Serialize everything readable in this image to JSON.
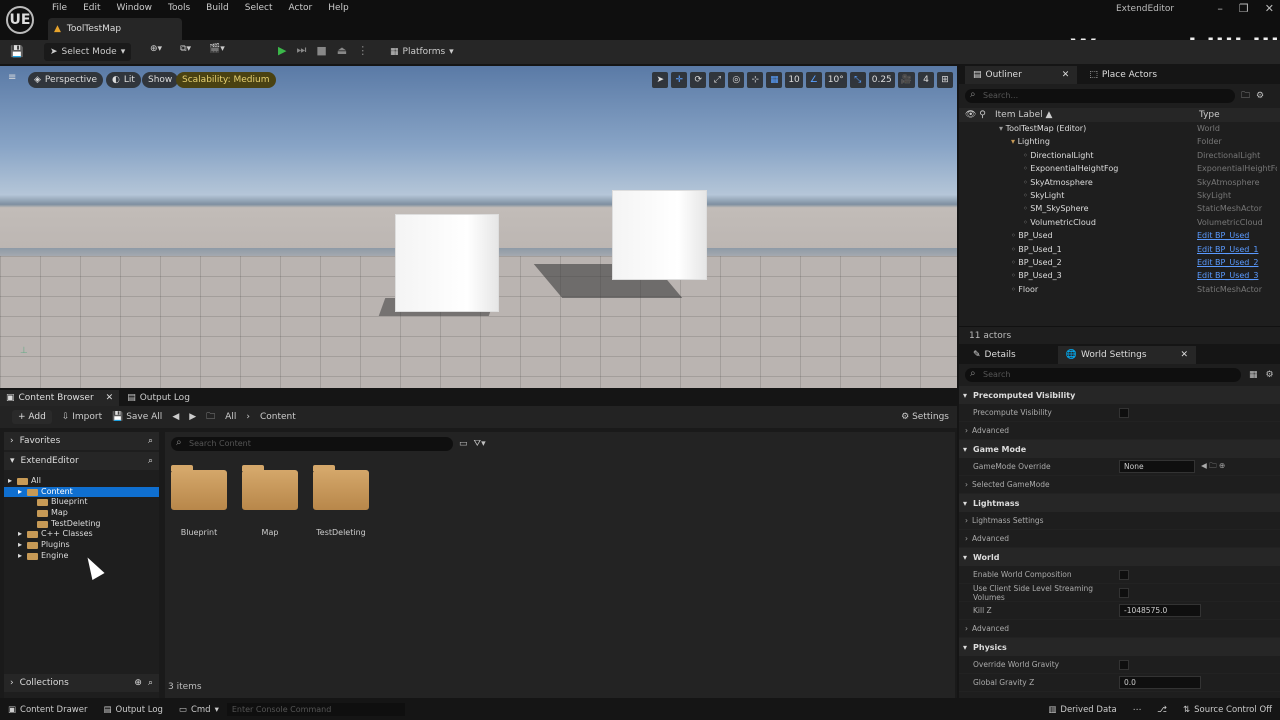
{
  "app": {
    "title": "ExtendEditor",
    "map_tab": "ToolTestMap",
    "logo": "UE",
    "watermark": "Wycc ヽ bilibili"
  },
  "menu": [
    "File",
    "Edit",
    "Window",
    "Tools",
    "Build",
    "Select",
    "Actor",
    "Help"
  ],
  "toolbar": {
    "select_mode": "Select Mode",
    "platforms": "Platforms"
  },
  "viewport": {
    "perspective": "Perspective",
    "lit": "Lit",
    "show": "Show",
    "scalability": "Scalability: Medium",
    "grid_snap": "10",
    "rot_snap": "10°",
    "scale_snap": "0.25",
    "camera_speed": "4"
  },
  "outliner": {
    "tab": "Outliner",
    "tab2": "Place Actors",
    "search_placeholder": "Search...",
    "col_label": "Item Label ▲",
    "col_type": "Type",
    "rows": [
      {
        "label": "ToolTestMap (Editor)",
        "type": "World",
        "indent": 0,
        "link": false
      },
      {
        "label": "Lighting",
        "type": "Folder",
        "indent": 1,
        "link": false
      },
      {
        "label": "DirectionalLight",
        "type": "DirectionalLight",
        "indent": 2,
        "link": false
      },
      {
        "label": "ExponentialHeightFog",
        "type": "ExponentialHeightFo",
        "indent": 2,
        "link": false
      },
      {
        "label": "SkyAtmosphere",
        "type": "SkyAtmosphere",
        "indent": 2,
        "link": false
      },
      {
        "label": "SkyLight",
        "type": "SkyLight",
        "indent": 2,
        "link": false
      },
      {
        "label": "SM_SkySphere",
        "type": "StaticMeshActor",
        "indent": 2,
        "link": false
      },
      {
        "label": "VolumetricCloud",
        "type": "VolumetricCloud",
        "indent": 2,
        "link": false
      },
      {
        "label": "BP_Used",
        "type": "Edit BP_Used",
        "indent": 1,
        "link": true
      },
      {
        "label": "BP_Used_1",
        "type": "Edit BP_Used_1",
        "indent": 1,
        "link": true
      },
      {
        "label": "BP_Used_2",
        "type": "Edit BP_Used_2",
        "indent": 1,
        "link": true
      },
      {
        "label": "BP_Used_3",
        "type": "Edit BP_Used_3",
        "indent": 1,
        "link": true
      },
      {
        "label": "Floor",
        "type": "StaticMeshActor",
        "indent": 1,
        "link": false
      }
    ],
    "footer": "11 actors"
  },
  "details": {
    "tab": "Details",
    "tab2": "World Settings",
    "search_placeholder": "Search",
    "items": [
      {
        "kind": "sec",
        "label": "Precomputed Visibility"
      },
      {
        "kind": "chk",
        "label": "Precompute Visibility"
      },
      {
        "kind": "sub",
        "label": "Advanced"
      },
      {
        "kind": "sec",
        "label": "Game Mode"
      },
      {
        "kind": "sel",
        "label": "GameMode Override",
        "value": "None"
      },
      {
        "kind": "sub",
        "label": "Selected GameMode"
      },
      {
        "kind": "sec",
        "label": "Lightmass"
      },
      {
        "kind": "sub",
        "label": "Lightmass Settings"
      },
      {
        "kind": "sub",
        "label": "Advanced"
      },
      {
        "kind": "sec",
        "label": "World"
      },
      {
        "kind": "chk",
        "label": "Enable World Composition"
      },
      {
        "kind": "chk",
        "label": "Use Client Side Level Streaming Volumes"
      },
      {
        "kind": "val",
        "label": "Kill Z",
        "value": "-1048575.0"
      },
      {
        "kind": "sub",
        "label": "Advanced"
      },
      {
        "kind": "sec",
        "label": "Physics"
      },
      {
        "kind": "chk",
        "label": "Override World Gravity"
      },
      {
        "kind": "val",
        "label": "Global Gravity Z",
        "value": "0.0"
      }
    ]
  },
  "content_browser": {
    "tab": "Content Browser",
    "tab2": "Output Log",
    "add": "+ Add",
    "import": "Import",
    "save_all": "Save All",
    "path": [
      "All",
      "Content"
    ],
    "settings": "Settings",
    "favorites": "Favorites",
    "project": "ExtendEditor",
    "search_placeholder": "Search Content",
    "tree": [
      {
        "label": "All",
        "indent": 0,
        "sel": false
      },
      {
        "label": "Content",
        "indent": 1,
        "sel": true
      },
      {
        "label": "Blueprint",
        "indent": 2,
        "sel": false
      },
      {
        "label": "Map",
        "indent": 2,
        "sel": false
      },
      {
        "label": "TestDeleting",
        "indent": 2,
        "sel": false
      },
      {
        "label": "C++ Classes",
        "indent": 1,
        "sel": false
      },
      {
        "label": "Plugins",
        "indent": 1,
        "sel": false
      },
      {
        "label": "Engine",
        "indent": 1,
        "sel": false
      }
    ],
    "assets": [
      "Blueprint",
      "Map",
      "TestDeleting"
    ],
    "collections": "Collections",
    "count": "3 items"
  },
  "statusbar": {
    "content_drawer": "Content Drawer",
    "output_log": "Output Log",
    "cmd": "Cmd",
    "console_placeholder": "Enter Console Command",
    "derived_data": "Derived Data",
    "source_control": "Source Control Off"
  },
  "colors": {
    "accent": "#0f6fd0",
    "link": "#5a9aff",
    "folder": "#c79a56",
    "play": "#3bb84a"
  }
}
